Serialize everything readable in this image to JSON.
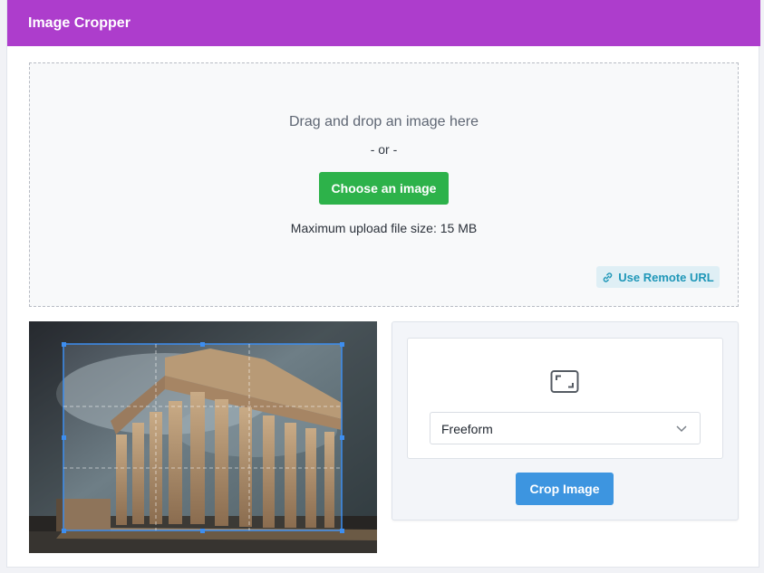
{
  "app": {
    "title": "Image Cropper"
  },
  "dropzone": {
    "title": "Drag and drop an image here",
    "or_text": "- or -",
    "choose_label": "Choose an image",
    "max_size": "Maximum upload file size: 15 MB",
    "remote_label": "Use Remote URL",
    "remote_icon": "link-icon"
  },
  "controls": {
    "ratio_icon": "aspect-ratio-icon",
    "aspect_select": {
      "selected": "Freeform"
    },
    "crop_label": "Crop Image"
  },
  "colors": {
    "header": "#ad3dcc",
    "choose_button": "#2db24a",
    "crop_button": "#3d95e0",
    "remote_link": "#1f97b8",
    "crop_frame": "#3d8ef0"
  }
}
